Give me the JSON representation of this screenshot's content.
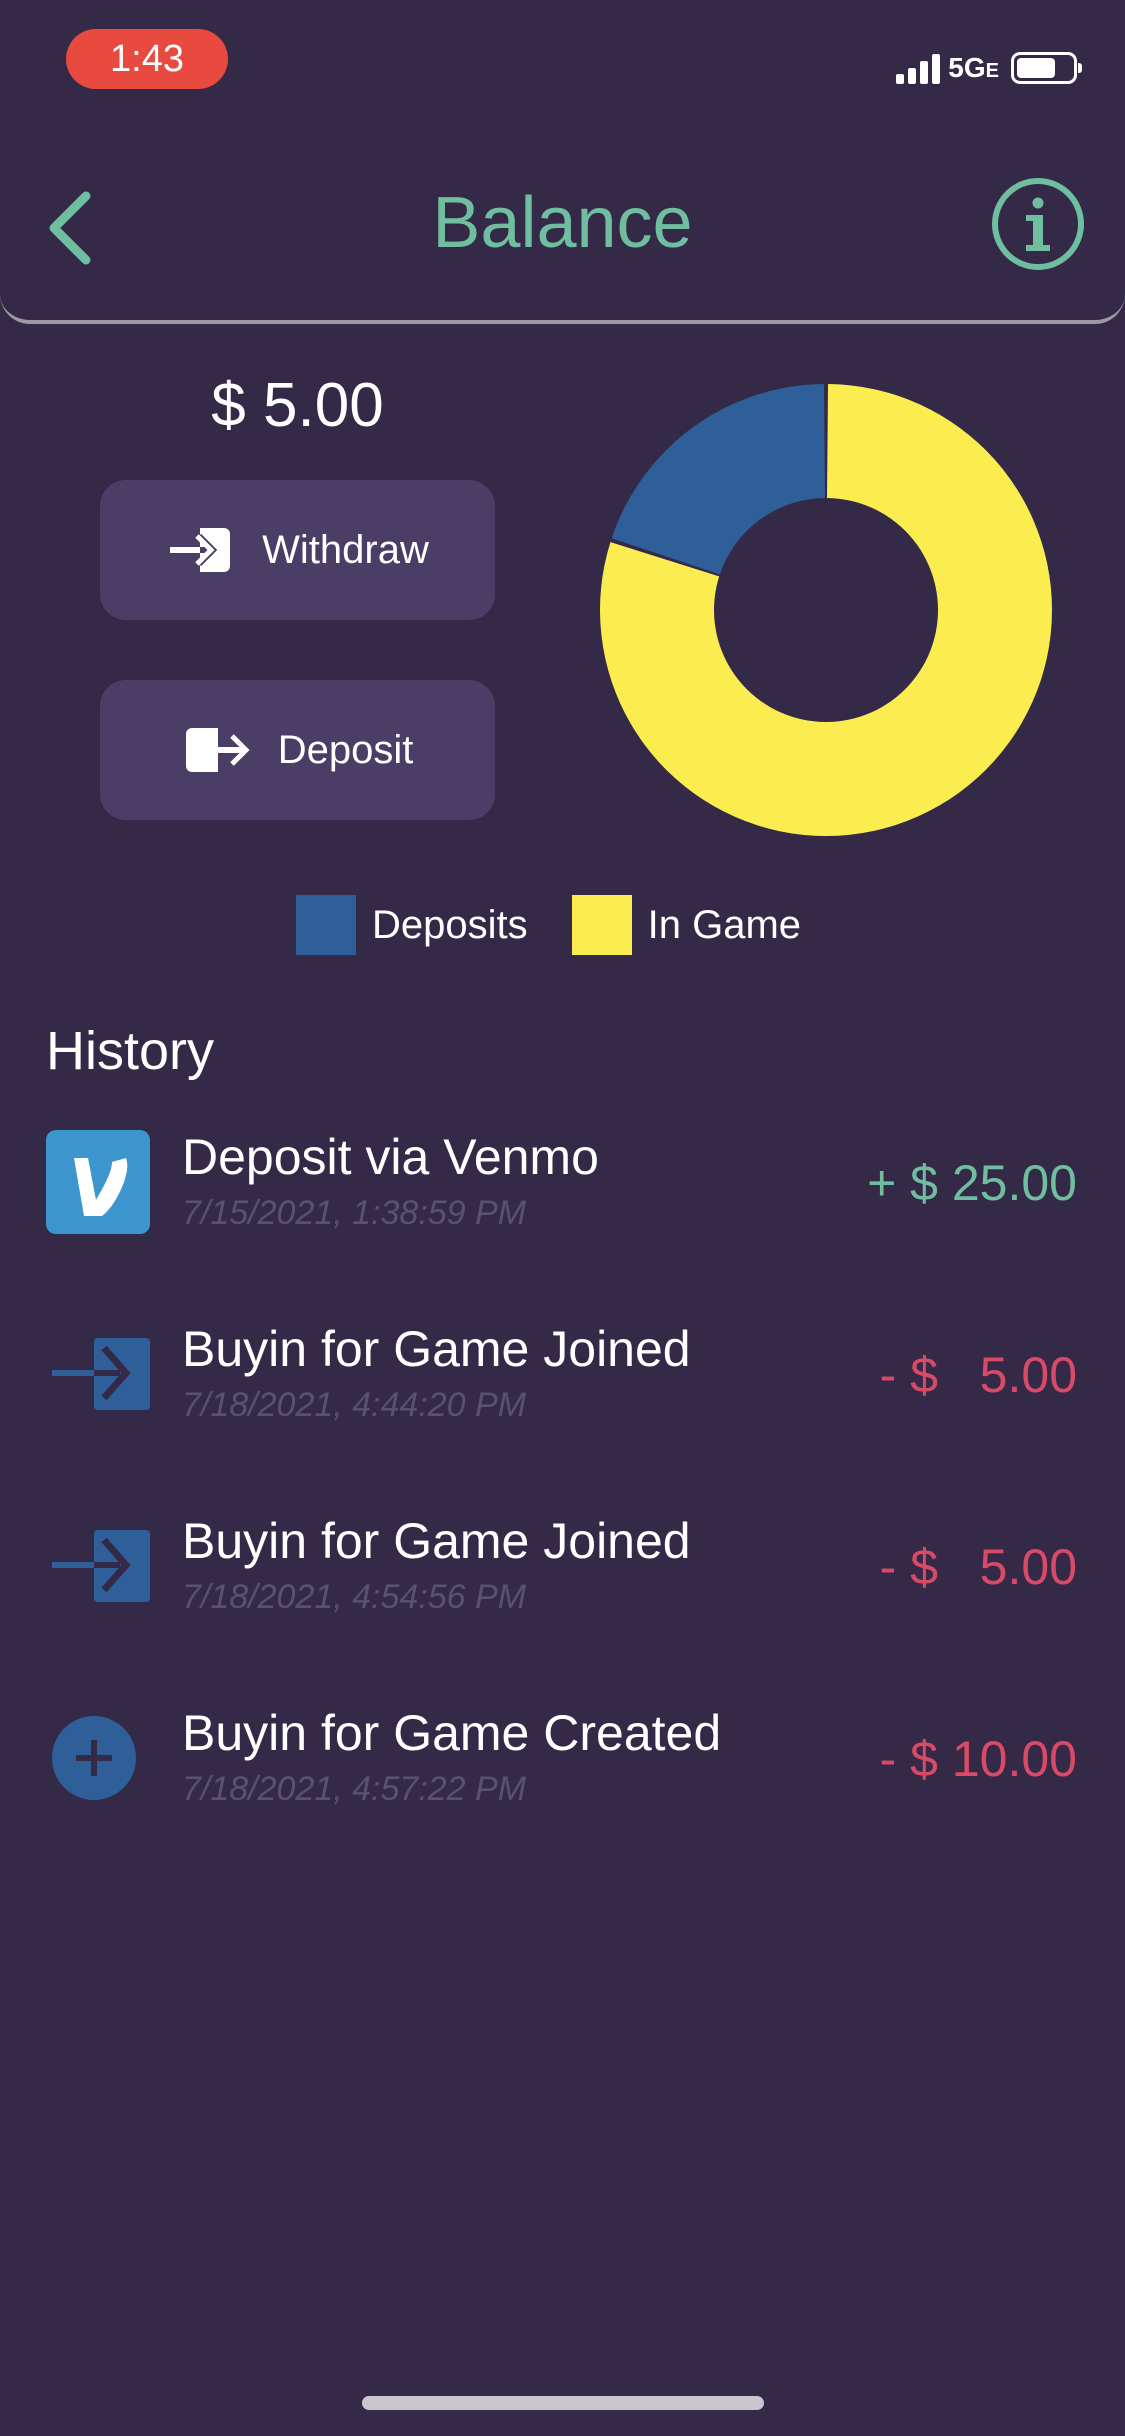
{
  "status_bar": {
    "time": "1:43",
    "network": "5G",
    "network_suffix": "E"
  },
  "header": {
    "title": "Balance",
    "back_icon": "chevron-left-icon",
    "info_icon": "info-circle-icon"
  },
  "balance": {
    "amount": "$ 5.00"
  },
  "actions": {
    "withdraw_label": "Withdraw",
    "deposit_label": "Deposit"
  },
  "chart_data": {
    "type": "pie",
    "style": "donut",
    "categories": [
      "Deposits",
      "In Game"
    ],
    "values": [
      20,
      80
    ],
    "colors": [
      "#2f5f99",
      "#fbed50"
    ],
    "legend": [
      "Deposits",
      "In Game"
    ]
  },
  "legend": {
    "deposits_label": "Deposits",
    "ingame_label": "In Game",
    "deposits_color": "#2f5f99",
    "ingame_color": "#fbed50"
  },
  "history": {
    "title": "History",
    "items": [
      {
        "icon": "venmo-icon",
        "title": "Deposit via Venmo",
        "date": "7/15/2021, 1:38:59 PM",
        "amount": "+ $ 25.00",
        "sign": "positive"
      },
      {
        "icon": "sign-in-icon",
        "title": "Buyin for Game Joined",
        "date": "7/18/2021, 4:44:20 PM",
        "amount": "- $   5.00",
        "sign": "negative"
      },
      {
        "icon": "sign-in-icon",
        "title": "Buyin for Game Joined",
        "date": "7/18/2021, 4:54:56 PM",
        "amount": "- $   5.00",
        "sign": "negative"
      },
      {
        "icon": "plus-circle-icon",
        "title": "Buyin for Game Created",
        "date": "7/18/2021, 4:57:22 PM",
        "amount": "- $ 10.00",
        "sign": "negative"
      }
    ]
  },
  "colors": {
    "background": "#342a48",
    "accent": "#6fbea0",
    "negative": "#d94a67",
    "button": "#4b3e66"
  }
}
